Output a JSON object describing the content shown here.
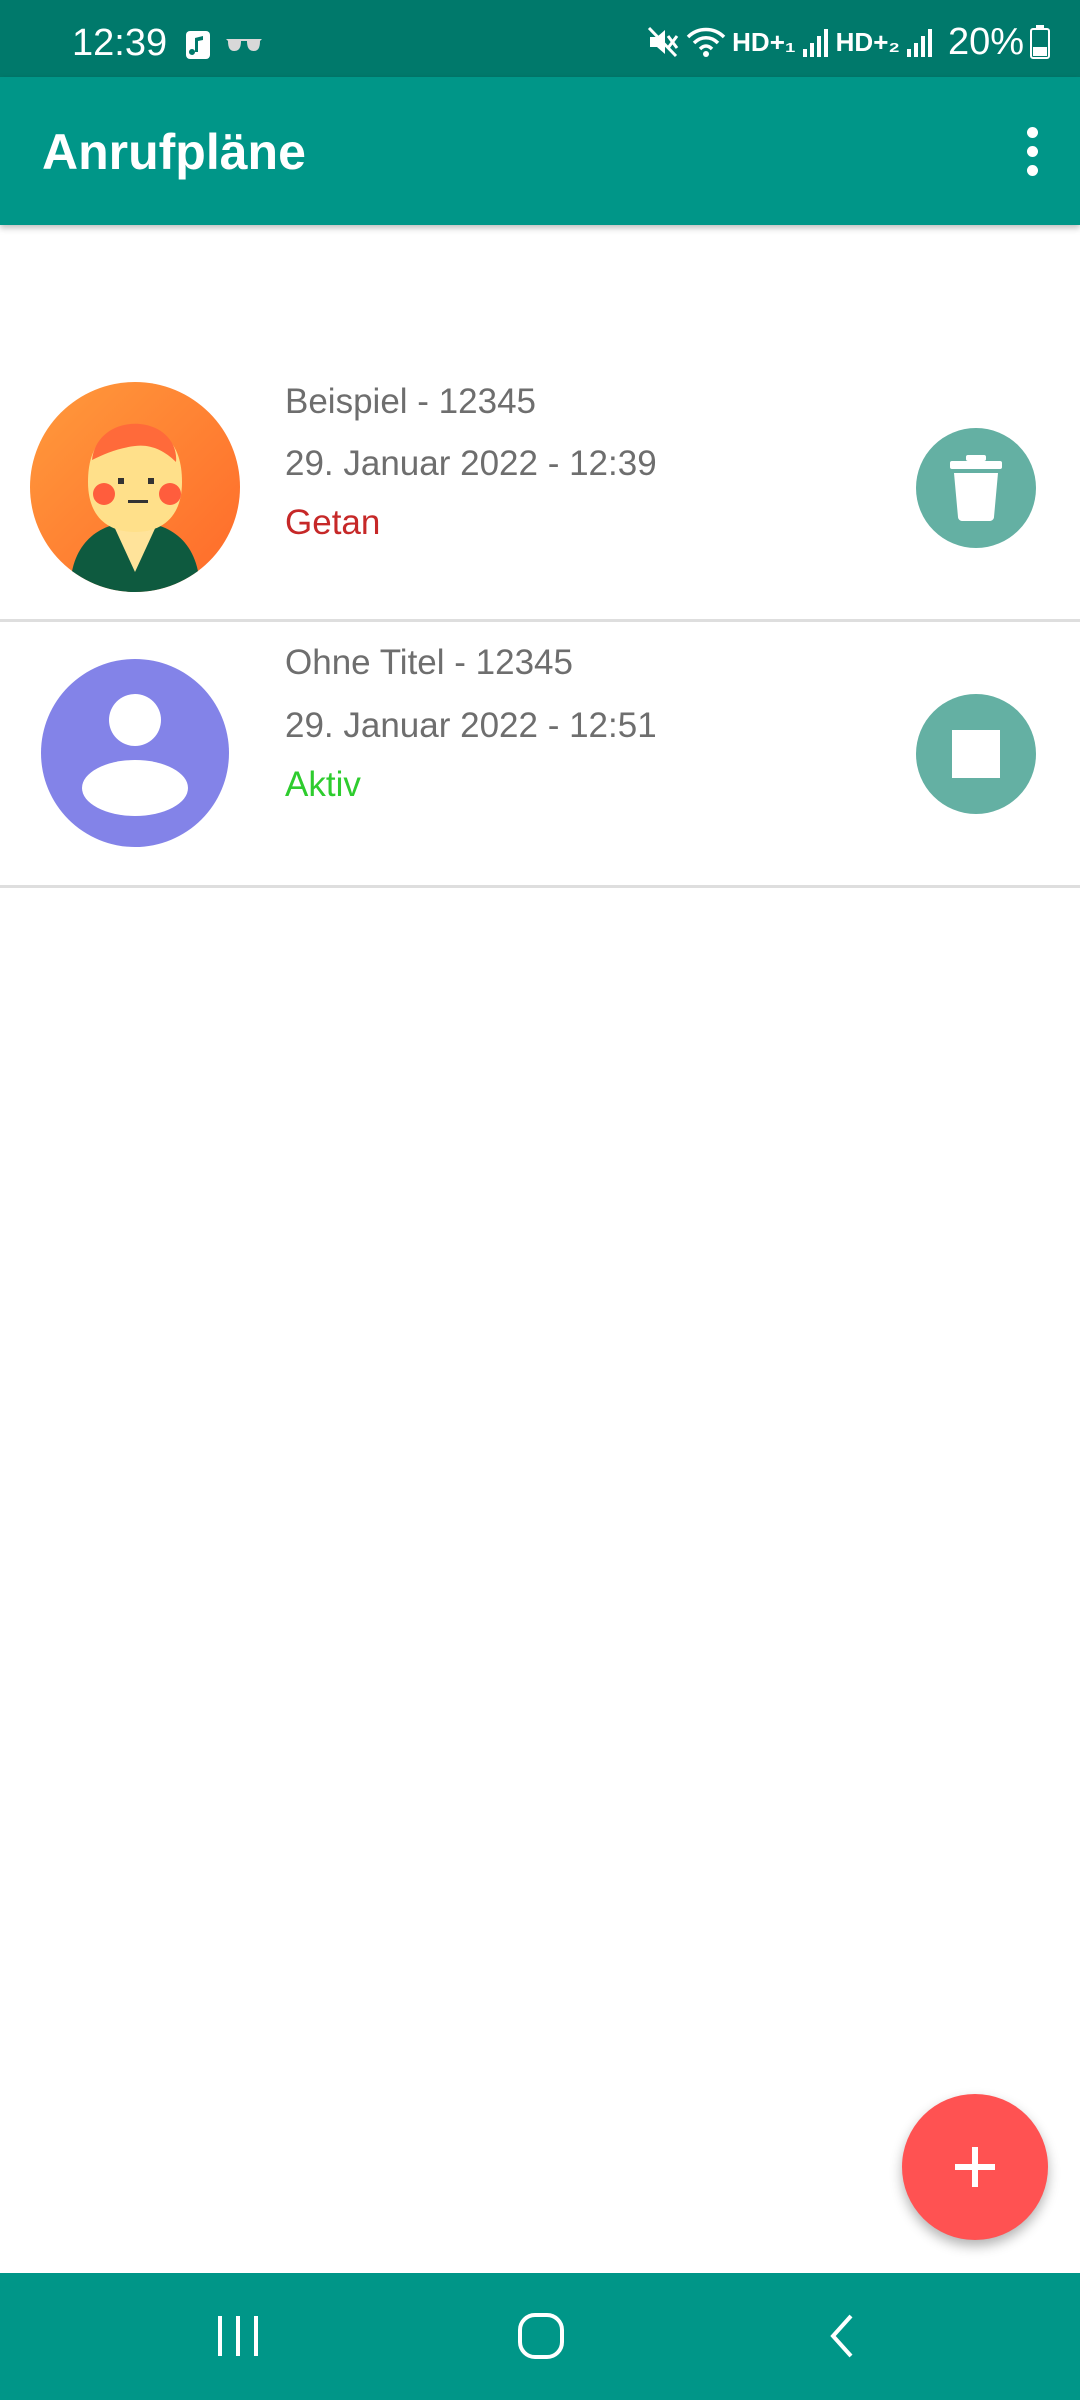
{
  "status_bar": {
    "time": "12:39",
    "network_1": "HD+₁",
    "network_2": "HD+₂",
    "battery": "20%"
  },
  "app_bar": {
    "title": "Anrufpläne",
    "menu_icon": "more-vert-icon"
  },
  "schedules": [
    {
      "line1": "Beispiel - 12345",
      "line2": "29. Januar 2022 - 12:39",
      "status": "Getan",
      "status_color": "#c62828",
      "avatar": "cartoon-avatar",
      "action_icon": "trash-icon"
    },
    {
      "line1": "Ohne Titel - 12345",
      "line2": "29. Januar 2022 - 12:51",
      "status": "Aktiv",
      "status_color": "#2ecc2e",
      "avatar": "default-person-avatar",
      "action_icon": "stop-icon"
    }
  ],
  "fab": {
    "icon": "plus-icon",
    "color": "#ff5252"
  },
  "colors": {
    "status_bar": "#00796b",
    "app_bar": "#009688",
    "action_button": "#64b0a3",
    "nav_bar": "#009688"
  },
  "nav": {
    "icons": [
      "recent-apps-icon",
      "home-icon",
      "back-icon"
    ]
  }
}
